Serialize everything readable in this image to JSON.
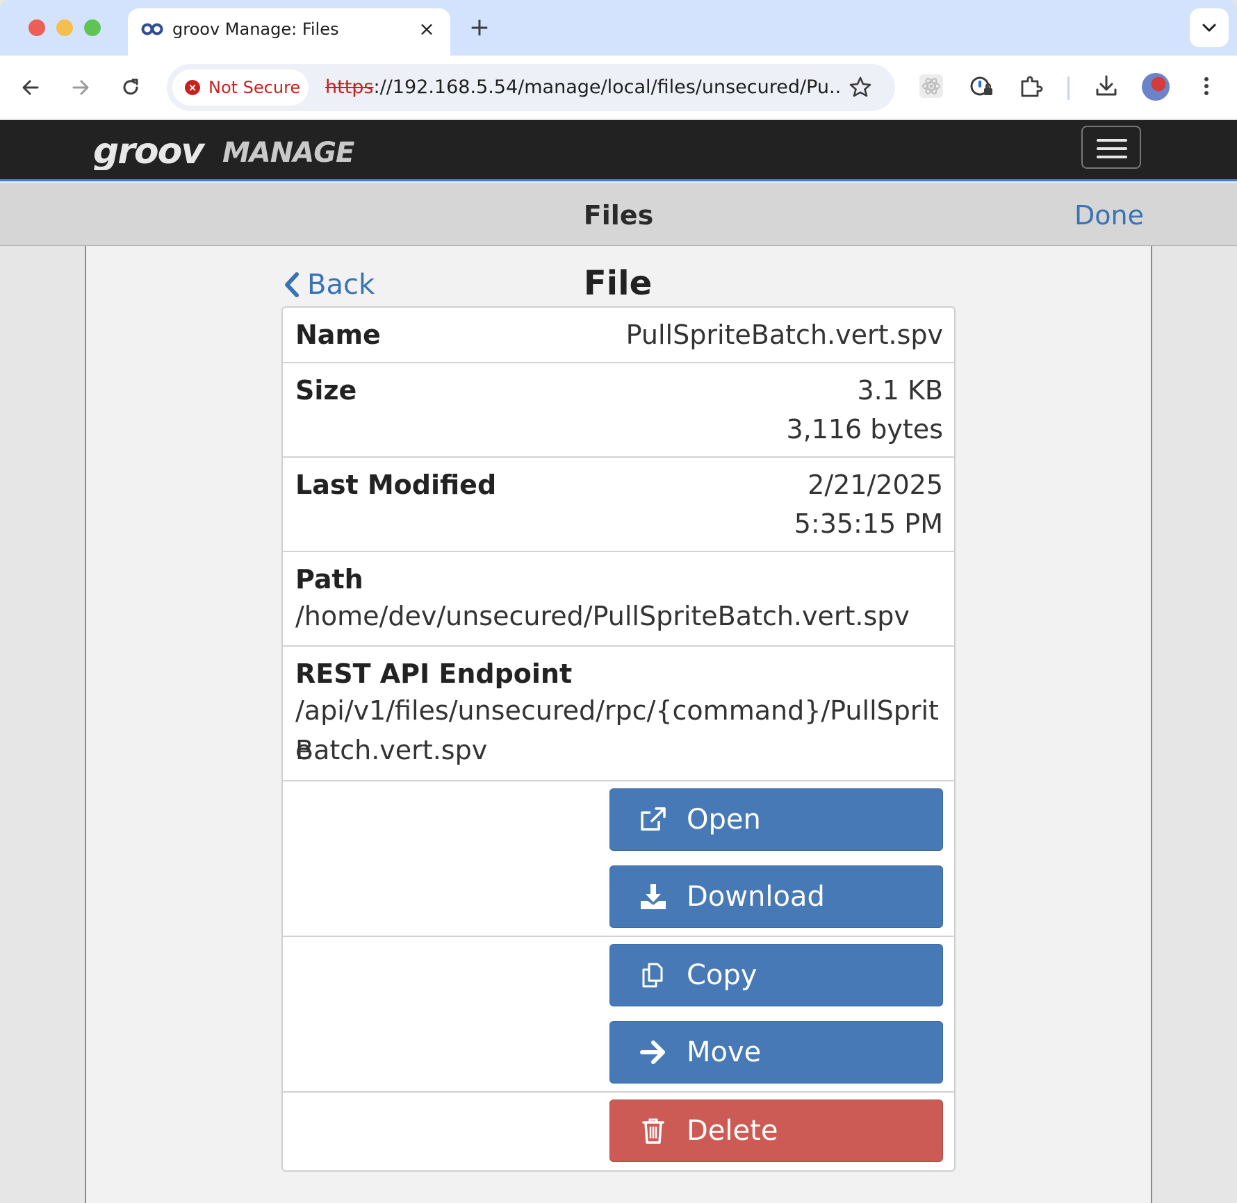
{
  "browser": {
    "tab_title": "groov Manage: Files",
    "security_label": "Not Secure",
    "url_scheme": "https",
    "url_rest": "://192.168.5.54/manage/local/files/unsecured/Pu..."
  },
  "app": {
    "logo_text": "groov MANAGE",
    "header_title": "Files",
    "done_label": "Done",
    "back_label": "Back",
    "page_title": "File"
  },
  "file": {
    "name_label": "Name",
    "name_value": "PullSpriteBatch.vert.spv",
    "size_label": "Size",
    "size_kb": "3.1 KB",
    "size_bytes": "3,116 bytes",
    "modified_label": "Last Modified",
    "modified_date": "2/21/2025",
    "modified_time": "5:35:15 PM",
    "path_label": "Path",
    "path_value": "/home/dev/unsecured/PullSpriteBatch.vert.spv",
    "endpoint_label": "REST API Endpoint",
    "endpoint_line1": "/api/v1/files/unsecured/rpc/{command}/PullSprite",
    "endpoint_line2": "Batch.vert.spv"
  },
  "actions": {
    "open": "Open",
    "download": "Download",
    "copy": "Copy",
    "move": "Move",
    "delete": "Delete"
  },
  "colors": {
    "primary": "#4679b5",
    "danger": "#cc5b55",
    "link": "#3a73b5",
    "navbar": "#222222"
  }
}
